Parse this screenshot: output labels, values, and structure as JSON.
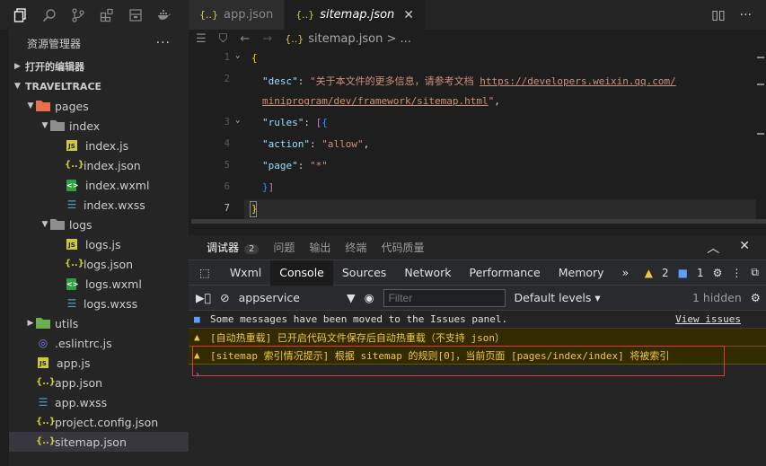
{
  "sidebar": {
    "title": "资源管理器",
    "more": "···",
    "open_editors": "打开的编辑器",
    "project": "TRAVELTRACE",
    "tree": [
      {
        "label": "pages",
        "type": "folder",
        "depth": 1,
        "open": true
      },
      {
        "label": "index",
        "type": "folder",
        "depth": 2,
        "open": true
      },
      {
        "label": "index.js",
        "type": "js",
        "depth": 3
      },
      {
        "label": "index.json",
        "type": "json",
        "depth": 3
      },
      {
        "label": "index.wxml",
        "type": "wxml",
        "depth": 3
      },
      {
        "label": "index.wxss",
        "type": "wxss",
        "depth": 3
      },
      {
        "label": "logs",
        "type": "folder",
        "depth": 2,
        "open": true
      },
      {
        "label": "logs.js",
        "type": "js",
        "depth": 3
      },
      {
        "label": "logs.json",
        "type": "json",
        "depth": 3
      },
      {
        "label": "logs.wxml",
        "type": "wxml",
        "depth": 3
      },
      {
        "label": "logs.wxss",
        "type": "wxss",
        "depth": 3
      },
      {
        "label": "utils",
        "type": "folder",
        "depth": 1,
        "open": false
      },
      {
        "label": ".eslintrc.js",
        "type": "eslint",
        "depth": 1
      },
      {
        "label": "app.js",
        "type": "js",
        "depth": 1
      },
      {
        "label": "app.json",
        "type": "json",
        "depth": 1
      },
      {
        "label": "app.wxss",
        "type": "wxss",
        "depth": 1
      },
      {
        "label": "project.config.json",
        "type": "json",
        "depth": 1
      },
      {
        "label": "sitemap.json",
        "type": "json",
        "depth": 1,
        "selected": true
      }
    ]
  },
  "tabs": [
    {
      "label": "app.json",
      "active": false
    },
    {
      "label": "sitemap.json",
      "active": true
    }
  ],
  "breadcrumb": {
    "file": "sitemap.json",
    "sep": ">",
    "rest": "..."
  },
  "editor": {
    "line_numbers": [
      "1",
      "2",
      "3",
      "4",
      "5",
      "6",
      "7"
    ],
    "desc_key": "\"desc\"",
    "desc_text": "\"关于本文件的更多信息，请参考文档 ",
    "desc_url1": "https://developers.weixin.qq.com/",
    "desc_url2": "miniprogram/dev/framework/sitemap.html",
    "rules_key": "\"rules\"",
    "action_key": "\"action\"",
    "action_val": "\"allow\"",
    "page_key": "\"page\"",
    "page_val": "\"*\""
  },
  "devtools": {
    "top_tabs": [
      "调试器",
      "问题",
      "输出",
      "终端",
      "代码质量"
    ],
    "badge": "2",
    "tabs": [
      "Wxml",
      "Console",
      "Sources",
      "Network",
      "Performance",
      "Memory"
    ],
    "more": "»",
    "warn_count": "2",
    "info_count": "1",
    "context": "appservice",
    "filter_placeholder": "Filter",
    "levels": "Default levels",
    "hidden": "1 hidden",
    "messages": [
      {
        "level": "info",
        "text": "Some messages have been moved to the Issues panel.",
        "link": "View issues"
      },
      {
        "level": "warn",
        "text": "[自动热重载] 已开启代码文件保存后自动热重载（不支持 json）"
      },
      {
        "level": "warn",
        "text": "[sitemap 索引情况提示] 根据 sitemap 的规则[0]，当前页面 [pages/index/index] 将被索引"
      }
    ]
  }
}
